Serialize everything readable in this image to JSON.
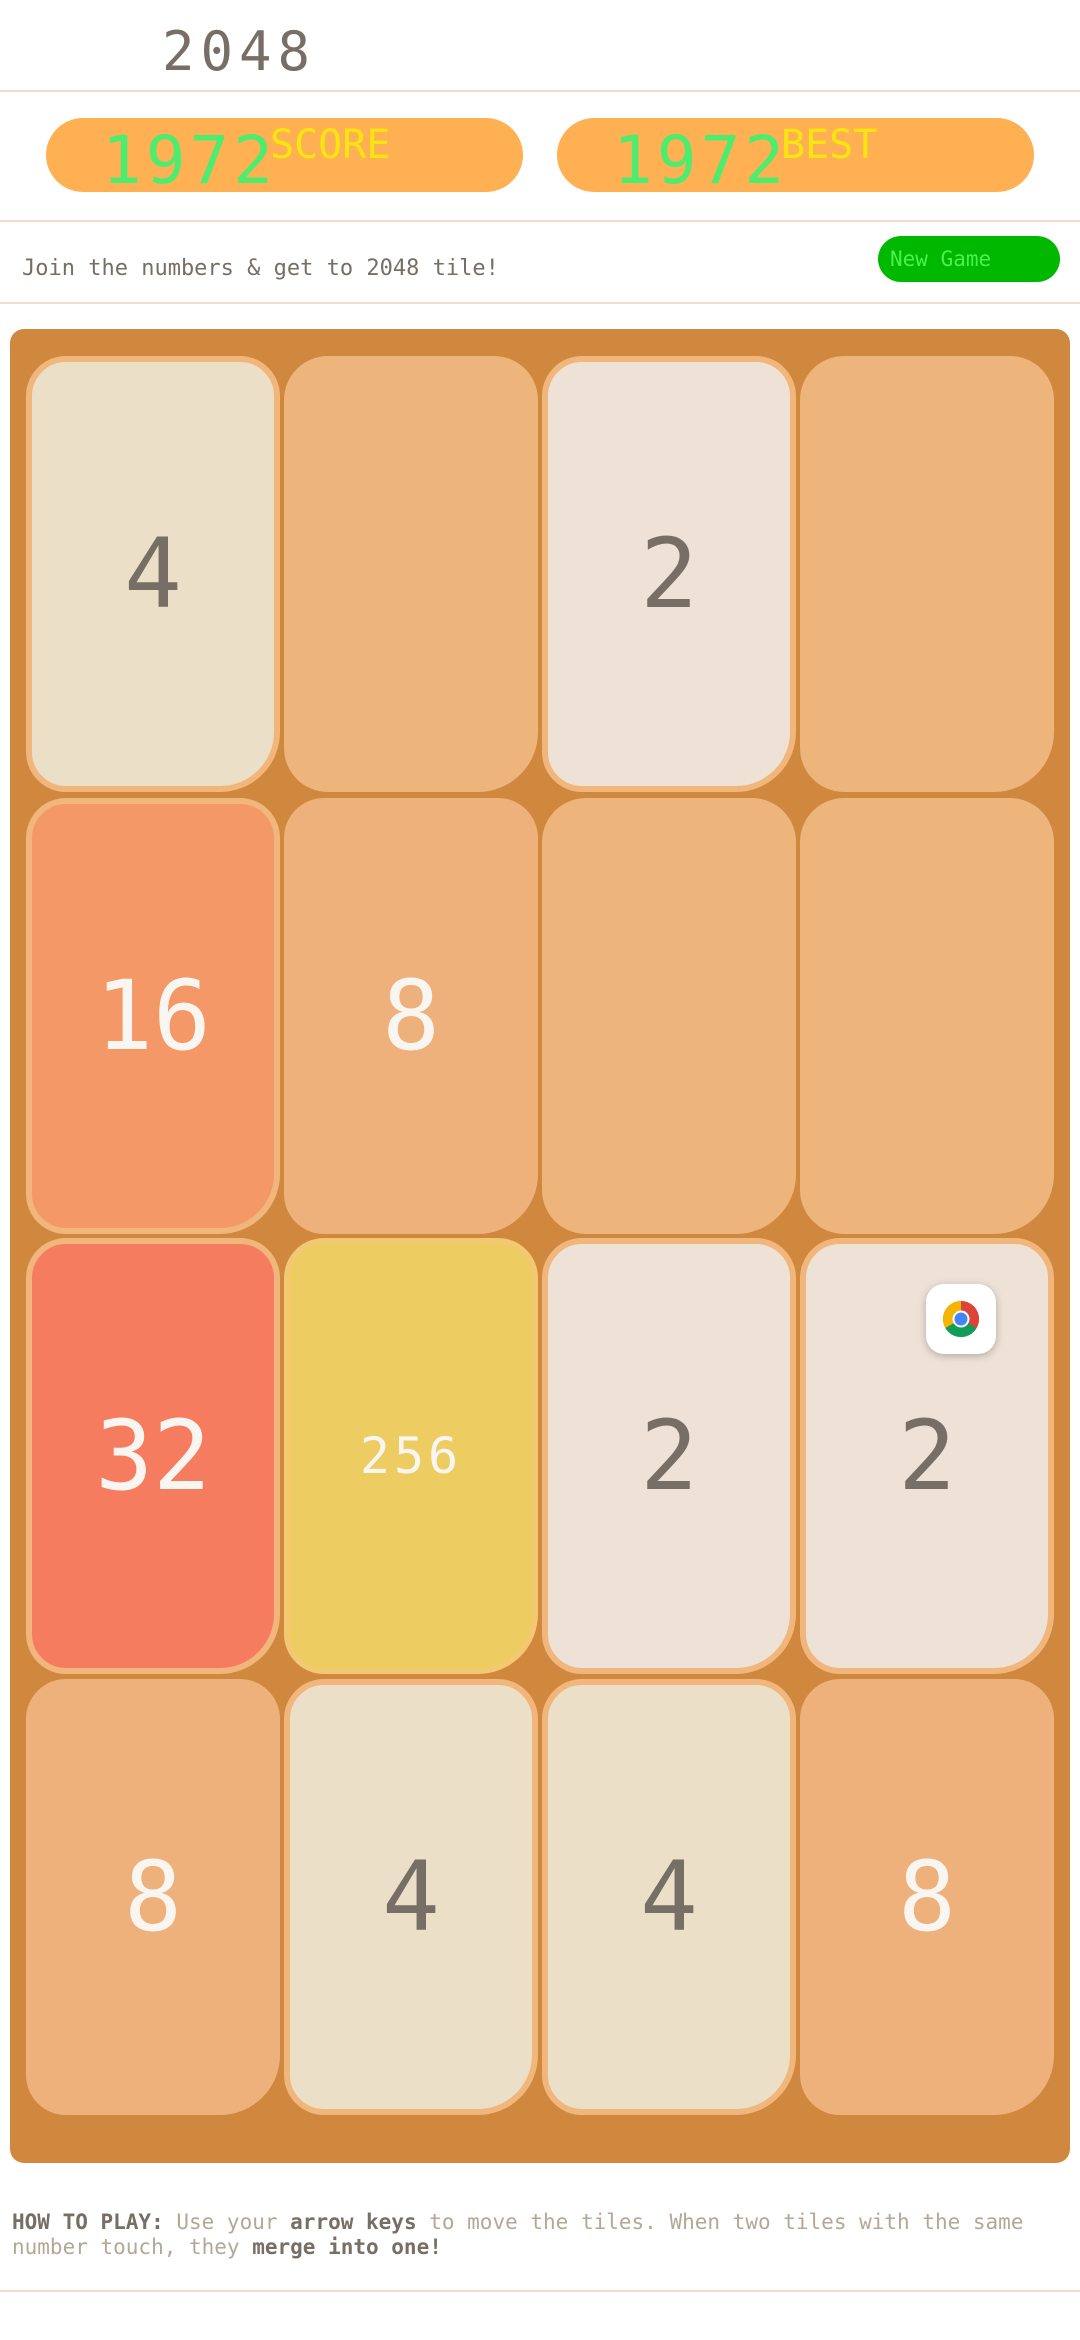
{
  "header": {
    "title": "2048"
  },
  "scores": {
    "score_value": "1972",
    "score_label": "SCORE",
    "best_value": "1972",
    "best_label": "BEST"
  },
  "intro": {
    "text": "Join the numbers & get to 2048 tile!",
    "new_game_label": "New Game"
  },
  "board": {
    "tiles": [
      "4",
      "",
      "2",
      "",
      "16",
      "8",
      "",
      "",
      "32",
      "256",
      "2",
      "2",
      "8",
      "4",
      "4",
      "8"
    ]
  },
  "overlay": {
    "icon": "chrome-icon"
  },
  "howto": {
    "heading": "HOW TO PLAY:",
    "part1": " Use your ",
    "bold1": "arrow keys",
    "part2": " to move the tiles. When two tiles with the same number touch, they ",
    "bold2": "merge into one!"
  },
  "colors": {
    "board": "#d0883e",
    "empty_tile": "#edb47b",
    "score_box": "#ffb052",
    "score_number": "#4cec6e",
    "score_label": "#f6e510",
    "new_game_bg": "#00b800",
    "new_game_text": "#4cf04c"
  }
}
